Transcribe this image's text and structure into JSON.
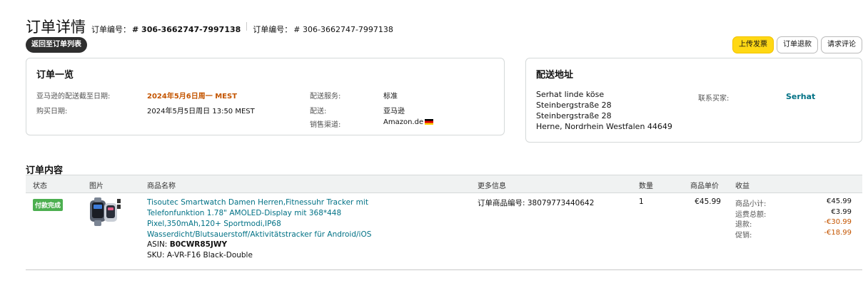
{
  "header": {
    "title": "订单详情",
    "order_label_1": "订单编号：",
    "order_value_1": "# 306-3662747-7997138",
    "order_label_2": "订单编号：",
    "order_value_2": "# 306-3662747-7997138",
    "back_button": "返回至订单列表"
  },
  "actions": {
    "upload_invoice": "上传发票",
    "refund": "订单退款",
    "request_review": "请求评论"
  },
  "summary": {
    "title": "订单一览",
    "delivery_deadline_label": "亚马逊的配送截至日期:",
    "delivery_deadline_value": "2024年5月6日周一 MEST",
    "purchase_date_label": "购买日期:",
    "purchase_date_value": "2024年5月5日周日 13:50 MEST",
    "shipping_service_label": "配送服务:",
    "shipping_service_value": "标准",
    "fulfillment_label": "配送:",
    "fulfillment_value": "亚马逊",
    "sales_channel_label": "销售渠道:",
    "sales_channel_value": "Amazon.de"
  },
  "address": {
    "title": "配送地址",
    "lines": [
      "Serhat linde köse",
      "Steinbergstraße 28",
      "Steinbergstraße 28",
      "Herne, Nordrhein Westfalen 44649"
    ],
    "contact_label": "联系买家:",
    "contact_name": "Serhat"
  },
  "contents": {
    "title": "订单内容",
    "columns": [
      "状态",
      "图片",
      "商品名称",
      "更多信息",
      "数量",
      "商品单价",
      "收益"
    ],
    "rows": [
      {
        "status": "付款完成",
        "product_name": "Tisoutec Smartwatch Damen Herren,Fitnessuhr Tracker mit Telefonfunktion 1.78\" AMOLED-Display mit 368*448 Pixel,350mAh,120+ Sportmodi,IP68 Wasserdicht/Blutsauerstoff/Aktivitätstracker für Android/iOS",
        "asin_label": "ASIN: ",
        "asin_value": "B0CWR85JWY",
        "sku": "SKU: A-VR-F16 Black-Double",
        "more_info": "订单商品编号: 38079773440642",
        "quantity": "1",
        "unit_price": "€45.99",
        "revenue": [
          {
            "label": "商品小计:",
            "value": "€45.99"
          },
          {
            "label": "运费总额:",
            "value": "€3.99"
          },
          {
            "label": "退款:",
            "value": "-€30.99"
          },
          {
            "label": "促销:",
            "value": "-€18.99"
          }
        ]
      }
    ]
  },
  "colors": {
    "link": "#007185",
    "highlight": "#c45500",
    "primary_button": "#ffd814",
    "status_badge": "#4caf50"
  }
}
